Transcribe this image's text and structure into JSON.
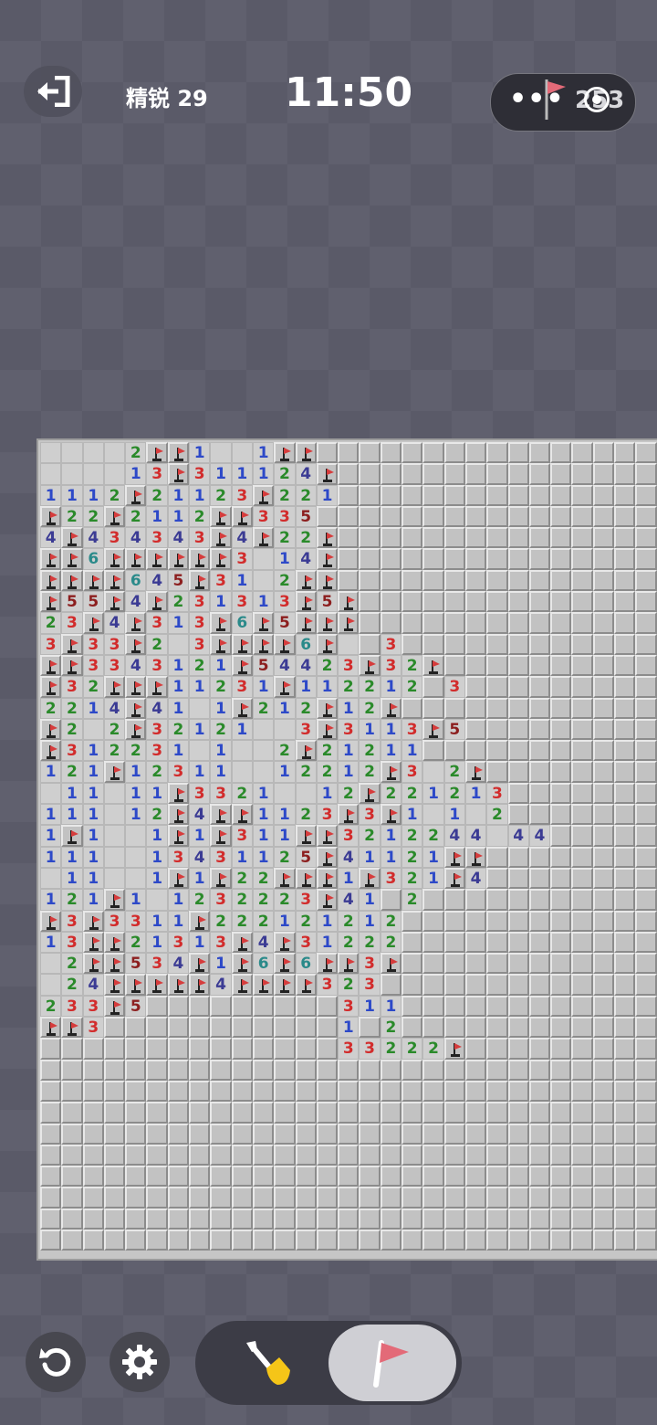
{
  "header": {
    "level_label": "精锐 29",
    "timer": "11:50",
    "menu_dots": "•••",
    "flags_remaining": "253"
  },
  "colors": {
    "n1": "#2d49c8",
    "n2": "#2a8a2a",
    "n3": "#d22c2c",
    "n4": "#3b3b94",
    "n5": "#8c1e1e",
    "n6": "#2a8a8a",
    "flag": "#d63c3c",
    "selected_mode": "#cfcfd4"
  },
  "board": {
    "columns": 30,
    "rows": 38,
    "legend": "F = flag, digit = revealed number, . = revealed empty, # = hidden",
    "cells": [
      "....2FF1..1FF#################",
      "....13F311124F################",
      "1112F21123F221################",
      "F22F2112FF335#################",
      "4F434343F4F22F################",
      "FF6FFFFFF3.14F################",
      "FFFF645F31.2FF################",
      "F55F4F231313F5F###############",
      "23F4F313F6F5FFF###############",
      "3F33F2.3FFFF6F.#3#############",
      "FF3343121F54423F32F###########",
      "F32FFF11231F112212#3##########",
      "2214F41.1F212F12F#############",
      "F2.2F32121..3F3113F5##########",
      "F312231.1..2F21211############",
      "121F12311..12212F3.2F#########",
      ".11.11F3321..12F221213########",
      "111.12F4FF1123F3F1.1.2########",
      "1F1..1F1F311FF3212244.44######",
      "111..13431125F41121FF#########",
      ".11..1F1F22FFF1F321F4#########",
      "121F1.1232223F41#2############",
      "F3F3311F222121212#############",
      "13FF21313F4F31222#############",
      ".2FF534F1F6F6FF3F#############",
      ".24FFFFF4FFFF323##############",
      "233F5#########311#############",
      "FF3###########1#2#############",
      "##############33222F##########",
      "##############################",
      "##############################",
      "##############################",
      "##############################",
      "##############################",
      "##############################",
      "##############################",
      "##############################",
      "##############################"
    ]
  },
  "controls": {
    "restart_icon": "restart-icon",
    "settings_icon": "gear-icon",
    "dig_icon": "shovel-icon",
    "flag_icon": "flag-icon",
    "selected_mode": "flag"
  }
}
